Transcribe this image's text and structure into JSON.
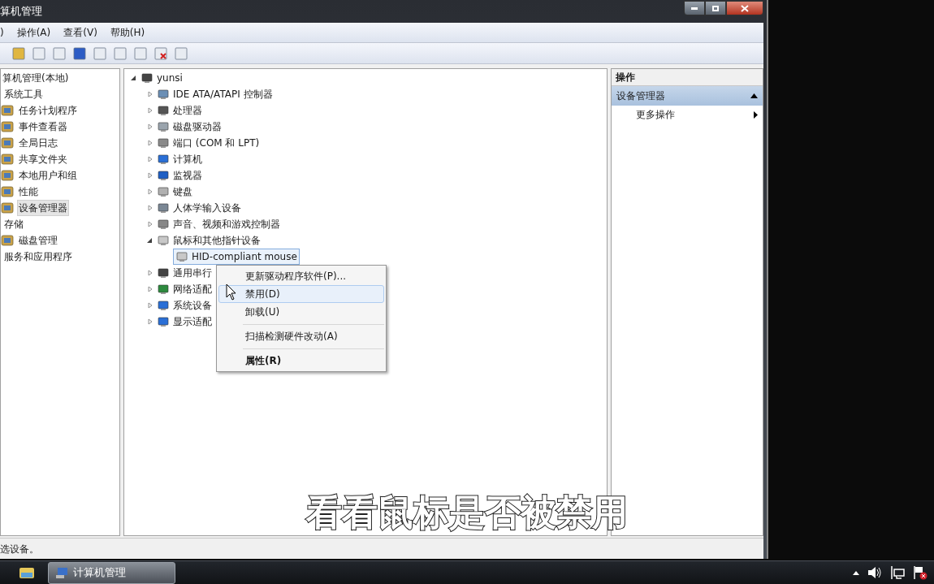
{
  "window": {
    "title": "算机管理"
  },
  "menu": [
    ")",
    "操作(A)",
    "查看(V)",
    "帮助(H)"
  ],
  "sidebar": {
    "items": [
      {
        "label": "算机管理(本地)",
        "children": [
          {
            "label": "系统工具",
            "children": [
              {
                "label": "任务计划程序",
                "selected": false
              },
              {
                "label": "事件查看器",
                "selected": false
              },
              {
                "label": "全局日志",
                "selected": false
              },
              {
                "label": "共享文件夹",
                "selected": false
              },
              {
                "label": "本地用户和组",
                "selected": false
              },
              {
                "label": "性能",
                "selected": false
              },
              {
                "label": "设备管理器",
                "selected": true
              }
            ],
            "selected": false
          },
          {
            "label": "存储",
            "children": [
              {
                "label": "磁盘管理",
                "selected": false
              }
            ],
            "selected": false
          },
          {
            "label": "服务和应用程序",
            "selected": false
          }
        ],
        "selected": false
      }
    ]
  },
  "device_tree": {
    "label": "yunsi",
    "expanded": true,
    "children": [
      {
        "label": "IDE ATA/ATAPI 控制器",
        "expanded": false
      },
      {
        "label": "处理器",
        "expanded": false
      },
      {
        "label": "磁盘驱动器",
        "expanded": false
      },
      {
        "label": "端口 (COM 和 LPT)",
        "expanded": false
      },
      {
        "label": "计算机",
        "expanded": false
      },
      {
        "label": "监视器",
        "expanded": false
      },
      {
        "label": "键盘",
        "expanded": false
      },
      {
        "label": "人体学输入设备",
        "expanded": false
      },
      {
        "label": "声音、视频和游戏控制器",
        "expanded": false
      },
      {
        "label": "鼠标和其他指针设备",
        "expanded": true,
        "children": [
          {
            "label": "HID-compliant mouse",
            "selected": true
          }
        ]
      },
      {
        "label": "通用串行",
        "expanded": false
      },
      {
        "label": "网络适配",
        "expanded": false
      },
      {
        "label": "系统设备",
        "expanded": false
      },
      {
        "label": "显示适配",
        "expanded": false
      }
    ]
  },
  "context_menu": [
    {
      "kind": "item",
      "label": "更新驱动程序软件(P)...",
      "selected": false,
      "default": false
    },
    {
      "kind": "item",
      "label": "禁用(D)",
      "selected": true,
      "default": false
    },
    {
      "kind": "item",
      "label": "卸载(U)",
      "selected": false,
      "default": false
    },
    {
      "kind": "separator"
    },
    {
      "kind": "item",
      "label": "扫描检测硬件改动(A)",
      "selected": false,
      "default": false
    },
    {
      "kind": "separator"
    },
    {
      "kind": "item",
      "label": "属性(R)",
      "selected": false,
      "default": true
    }
  ],
  "actions": {
    "title": "操作",
    "section": {
      "label": "设备管理器",
      "expanded": true
    },
    "items": [
      {
        "label": "更多操作"
      }
    ]
  },
  "status_bar": "选设备。",
  "taskbar": {
    "tasks": [
      {
        "label": "计算机管理",
        "selected": true
      }
    ]
  },
  "caption": "看看鼠标是否被禁用"
}
